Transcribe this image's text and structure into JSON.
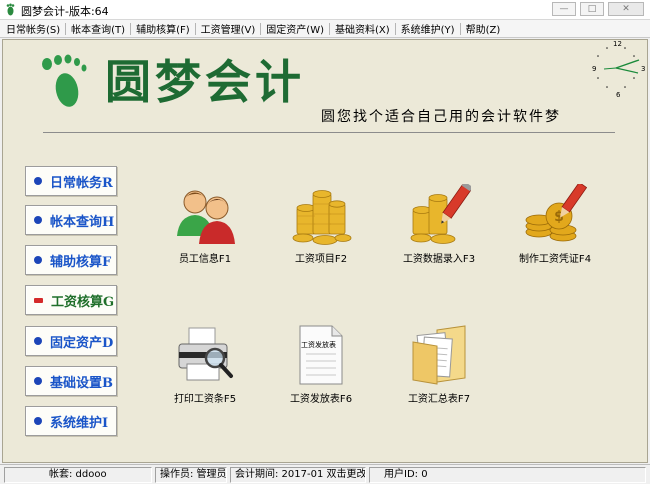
{
  "window": {
    "title": "圆梦会计-版本:64",
    "controls": {
      "minimize": "—",
      "maximize": "□",
      "close": "✕"
    }
  },
  "menu": [
    "日常帐务(S)",
    "帐本查询(T)",
    "辅助核算(F)",
    "工资管理(V)",
    "固定资产(W)",
    "基础资料(X)",
    "系统维护(Y)",
    "帮助(Z)"
  ],
  "brand": {
    "logo_text": "圆梦会计",
    "slogan": "圆您找个适合自己用的会计软件梦",
    "logo_color": "#1e6b33"
  },
  "clock": {
    "n12": "12",
    "n3": "3",
    "n6": "6",
    "n9": "9"
  },
  "nav": [
    {
      "label": "日常帐务R",
      "active": false
    },
    {
      "label": "帐本查询H",
      "active": false
    },
    {
      "label": "辅助核算F",
      "active": false
    },
    {
      "label": "工资核算G",
      "active": true
    },
    {
      "label": "固定资产D",
      "active": false
    },
    {
      "label": "基础设置B",
      "active": false
    },
    {
      "label": "系统维护I",
      "active": false
    }
  ],
  "functions": [
    {
      "label": "员工信息F1",
      "icon": "people-icon"
    },
    {
      "label": "工资项目F2",
      "icon": "coins-icon"
    },
    {
      "label": "工资数据录入F3",
      "icon": "coins-pencil-icon"
    },
    {
      "label": "制作工资凭证F4",
      "icon": "gold-coins-pencil-icon"
    },
    {
      "label": "打印工资条F5",
      "icon": "printer-magnifier-icon"
    },
    {
      "label": "工资发放表F6",
      "icon": "document-icon",
      "doc_title": "工资发放表"
    },
    {
      "label": "工资汇总表F7",
      "icon": "folder-docs-icon"
    }
  ],
  "status": {
    "ledger": "帐套: ddooo",
    "operator": "操作员: 管理员",
    "period": "会计期间: 2017-01 双击更改",
    "user_id": "用户ID: 0"
  }
}
